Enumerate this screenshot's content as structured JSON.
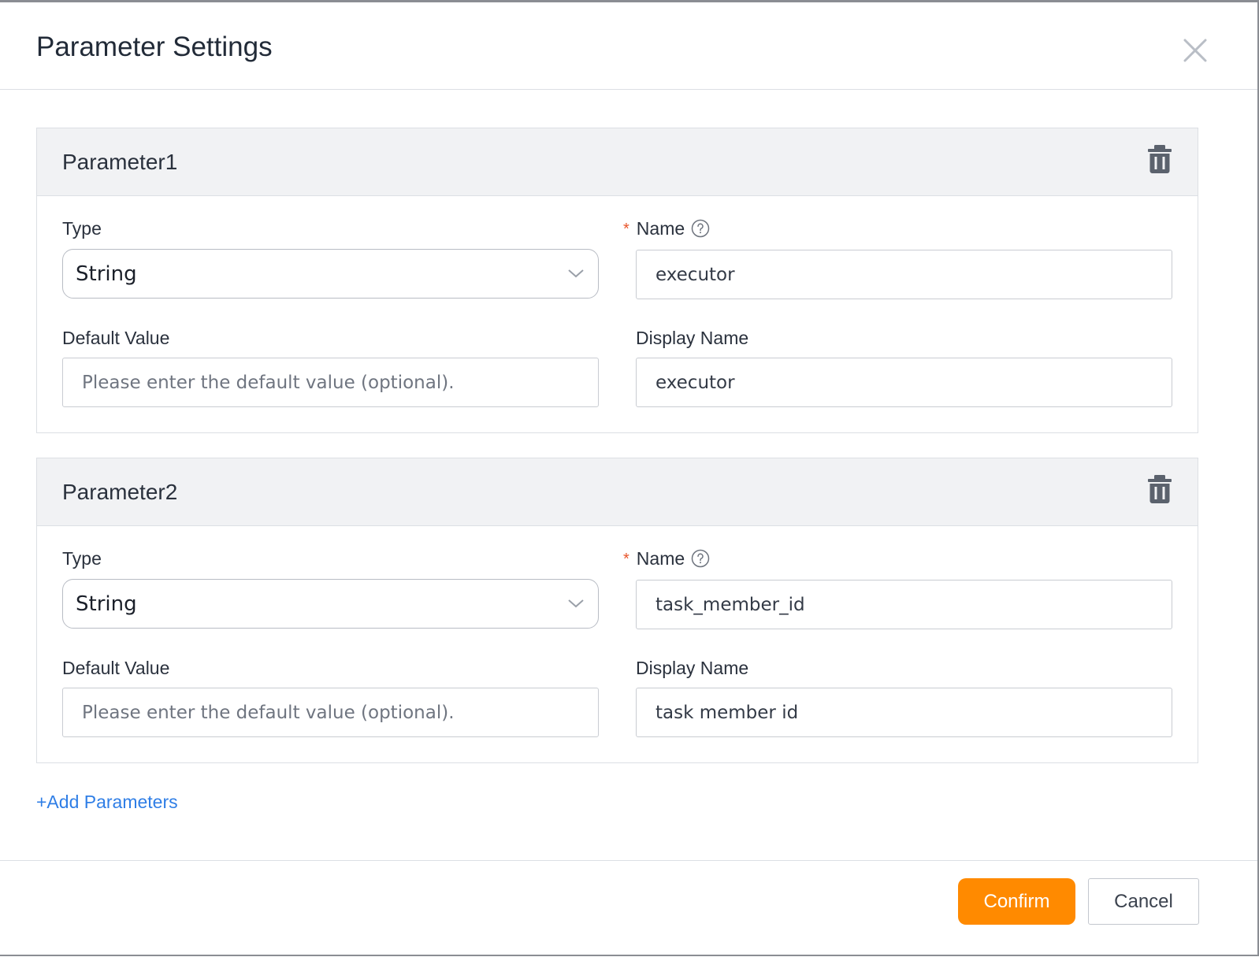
{
  "dialog": {
    "title": "Parameter Settings",
    "close_icon": "close-icon"
  },
  "parameters": [
    {
      "title": "Parameter1",
      "type_label": "Type",
      "type_value": "String",
      "name_label": "Name",
      "name_required": true,
      "name_value": "executor",
      "default_label": "Default Value",
      "default_value": "",
      "default_placeholder": "Please enter the default value (optional).",
      "display_label": "Display Name",
      "display_value": "executor"
    },
    {
      "title": "Parameter2",
      "type_label": "Type",
      "type_value": "String",
      "name_label": "Name",
      "name_required": true,
      "name_value": "task_member_id",
      "default_label": "Default Value",
      "default_value": "",
      "default_placeholder": "Please enter the default value (optional).",
      "display_label": "Display Name",
      "display_value": "task member id"
    }
  ],
  "add_link": "+Add Parameters",
  "footer": {
    "confirm_label": "Confirm",
    "cancel_label": "Cancel"
  },
  "colors": {
    "accent": "#ff8a00",
    "link": "#2f7ee6",
    "required": "#e8552b"
  },
  "icons": {
    "delete": "trash-icon",
    "help": "question-circle-icon",
    "dropdown": "chevron-down-icon"
  }
}
